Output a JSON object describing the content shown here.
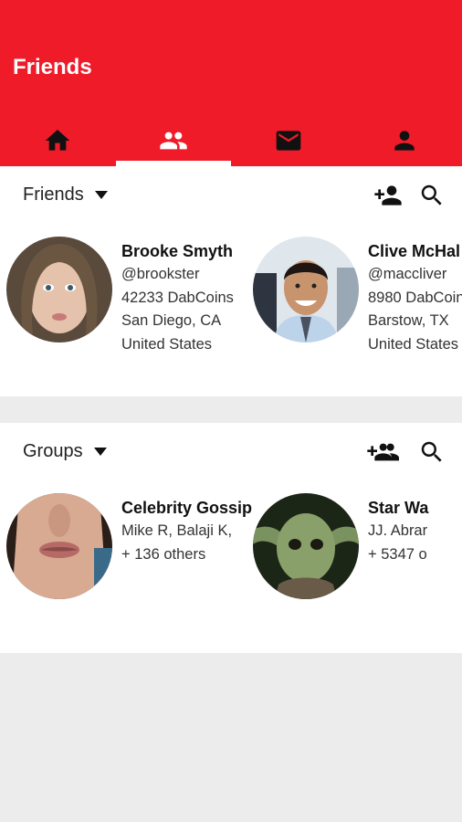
{
  "appbar": {
    "title": "Friends",
    "accent_color": "#ef1b29",
    "tabs": [
      {
        "icon": "home-icon",
        "active": false
      },
      {
        "icon": "people-icon",
        "active": true
      },
      {
        "icon": "mail-icon",
        "active": false
      },
      {
        "icon": "person-icon",
        "active": false
      }
    ]
  },
  "friends": {
    "title": "Friends",
    "actions": [
      "add-person-icon",
      "search-icon"
    ],
    "items": [
      {
        "name": "Brooke Smyth",
        "handle": "@brookster",
        "coins": "42233 DabCoins",
        "city": "San Diego, CA",
        "country": "United States"
      },
      {
        "name": "Clive McHal",
        "handle": "@maccliver",
        "coins": "8980 DabCoin",
        "city": "Barstow, TX",
        "country": "United States"
      }
    ]
  },
  "groups": {
    "title": "Groups",
    "actions": [
      "add-group-icon",
      "search-icon"
    ],
    "items": [
      {
        "name": "Celebrity Gossip",
        "members": "Mike R, Balaji K,",
        "others": "+ 136 others"
      },
      {
        "name": "Star Wa",
        "members": "JJ. Abrar",
        "others": "+ 5347 o"
      }
    ]
  }
}
